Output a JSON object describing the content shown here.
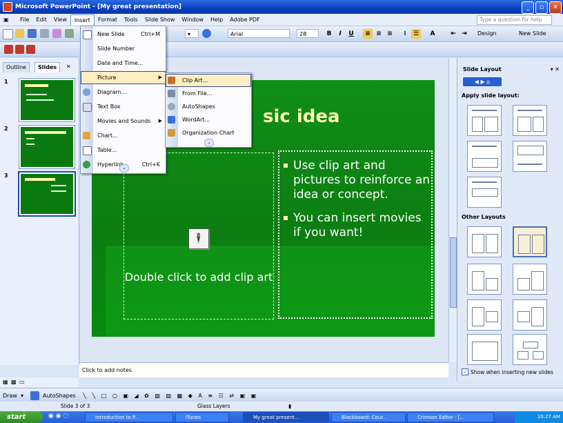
{
  "window": {
    "title": "Microsoft PowerPoint - [My great presentation]"
  },
  "menubar": {
    "items": [
      "File",
      "Edit",
      "View",
      "Insert",
      "Format",
      "Tools",
      "Slide Show",
      "Window",
      "Help",
      "Adobe PDF"
    ],
    "ask_placeholder": "Type a question for help"
  },
  "formatting": {
    "font_size": "28",
    "font_name": "Arial",
    "design_label": "Design",
    "new_slide_label": "New Slide"
  },
  "left_panel": {
    "tabs": [
      "Outline",
      "Slides"
    ],
    "thumb_numbers": [
      "1",
      "2",
      "3"
    ]
  },
  "insert_menu": {
    "items": [
      {
        "label": "New Slide",
        "shortcut": "Ctrl+M"
      },
      {
        "label": "Slide Number",
        "shortcut": ""
      },
      {
        "label": "Date and Time...",
        "shortcut": ""
      },
      {
        "label": "Picture",
        "shortcut": ""
      },
      {
        "label": "Diagram...",
        "shortcut": ""
      },
      {
        "label": "Text Box",
        "shortcut": ""
      },
      {
        "label": "Movies and Sounds",
        "shortcut": ""
      },
      {
        "label": "Chart...",
        "shortcut": ""
      },
      {
        "label": "Table...",
        "shortcut": ""
      },
      {
        "label": "Hyperlink...",
        "shortcut": "Ctrl+K"
      }
    ]
  },
  "picture_submenu": {
    "items": [
      "Clip Art...",
      "From File...",
      "AutoShapes",
      "WordArt...",
      "Organization Chart"
    ]
  },
  "slide": {
    "title_visible": "sic idea",
    "clip_placeholder": "Double click to add clip art",
    "bullets": [
      "Use clip art and pictures to reinforce an idea or concept.",
      "You can insert movies if you want!"
    ]
  },
  "notes": {
    "placeholder": "Click to add notes"
  },
  "task_pane": {
    "title": "Slide Layout",
    "apply_label": "Apply slide layout:",
    "other_label": "Other Layouts",
    "show_checkbox_label": "Show when inserting new slides"
  },
  "drawing_toolbar": {
    "draw_label": "Draw",
    "autoshapes_label": "AutoShapes"
  },
  "status": {
    "slide": "Slide 3 of 3",
    "design": "Glass Layers"
  },
  "taskbar": {
    "start": "start",
    "items": [
      "Introduction to P...",
      "iTunes",
      "My great present...",
      "Blackboard: Cour...",
      "Crimson Editor - [..."
    ],
    "clock": "10:27 AM"
  }
}
